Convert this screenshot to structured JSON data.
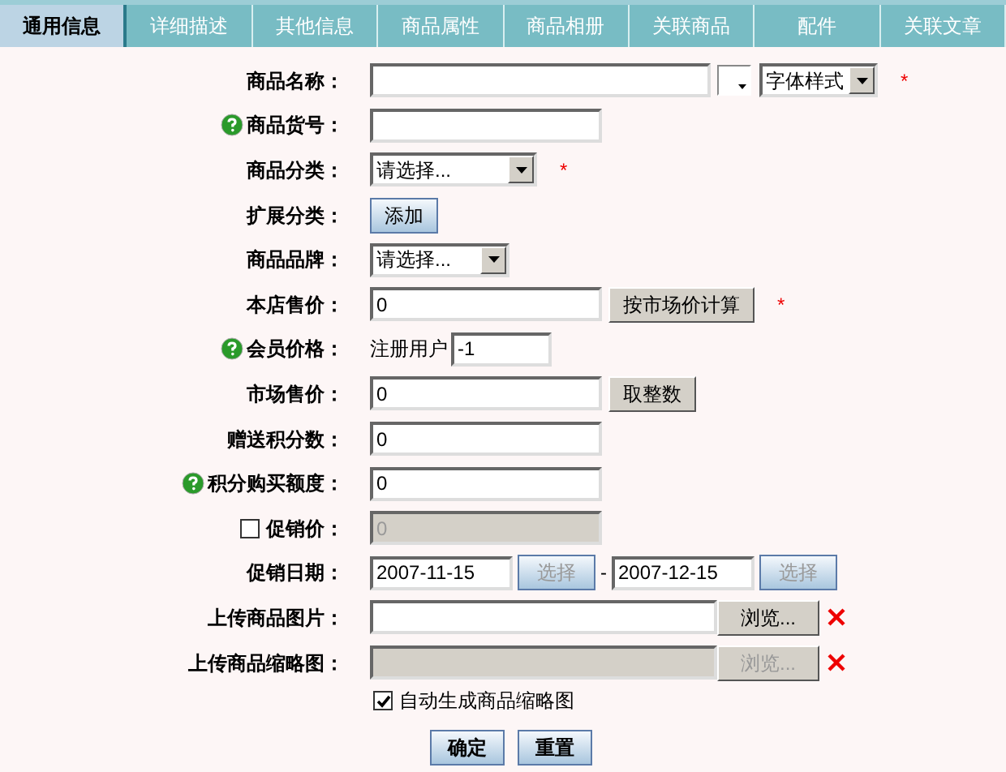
{
  "tabs": [
    {
      "label": "通用信息",
      "selected": true
    },
    {
      "label": "详细描述",
      "selected": false
    },
    {
      "label": "其他信息",
      "selected": false
    },
    {
      "label": "商品属性",
      "selected": false
    },
    {
      "label": "商品相册",
      "selected": false
    },
    {
      "label": "关联商品",
      "selected": false
    },
    {
      "label": "配件",
      "selected": false
    },
    {
      "label": "关联文章",
      "selected": false
    }
  ],
  "fields": [
    {
      "kind": "name",
      "label": "商品名称：",
      "help": false,
      "font_style": "字体样式",
      "required": "*"
    },
    {
      "kind": "text",
      "label": "商品货号：",
      "help": true
    },
    {
      "kind": "select",
      "label": "商品分类：",
      "help": false,
      "value": "请选择...",
      "required": "*"
    },
    {
      "kind": "button",
      "label": "扩展分类：",
      "help": false,
      "button": "添加"
    },
    {
      "kind": "select",
      "label": "商品品牌：",
      "help": false,
      "value": "请选择..."
    },
    {
      "kind": "text",
      "label": "本店售价：",
      "help": false,
      "value": "0",
      "button": "按市场价计算",
      "required": "*"
    },
    {
      "kind": "member",
      "label": "会员价格：",
      "help": true,
      "user": "注册用户",
      "value": "-1"
    },
    {
      "kind": "text",
      "label": "市场售价：",
      "help": false,
      "value": "0",
      "button": "取整数"
    },
    {
      "kind": "text",
      "label": "赠送积分数：",
      "help": false,
      "value": "0"
    },
    {
      "kind": "text",
      "label": "积分购买额度：",
      "help": true,
      "value": "0"
    },
    {
      "kind": "check_text",
      "label": "促销价：",
      "help": false,
      "checked": false,
      "value": "0",
      "disabled": true
    },
    {
      "kind": "dates",
      "label": "促销日期：",
      "help": false,
      "start": "2007-11-15",
      "end": "2007-12-15",
      "button": "选择",
      "end_button": "选择",
      "separator": "-"
    },
    {
      "kind": "file",
      "label": "上传商品图片：",
      "help": false,
      "button": "浏览...",
      "disabled": false
    },
    {
      "kind": "file",
      "label": "上传商品缩略图：",
      "help": false,
      "button": "浏览...",
      "disabled": true
    }
  ],
  "auto_thumb": {
    "label": "自动生成商品缩略图",
    "checked": true
  },
  "actions": [
    "确定",
    "重置"
  ]
}
